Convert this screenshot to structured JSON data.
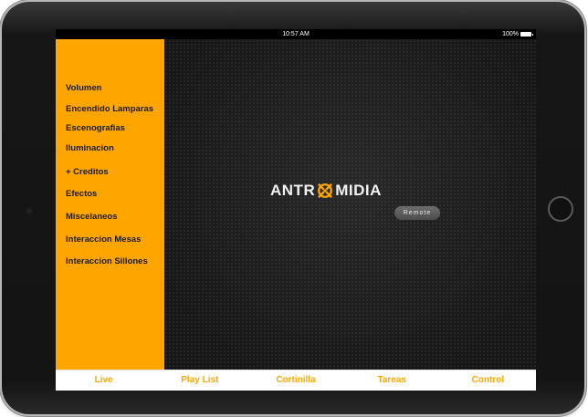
{
  "status_bar": {
    "time": "10:57 AM",
    "battery": "100%"
  },
  "sidebar": {
    "items": [
      {
        "label": "Volumen"
      },
      {
        "label": "Encendido Lamparas"
      },
      {
        "label": "Escenografias"
      },
      {
        "label": "Iluminacion"
      },
      {
        "label": "+ Creditos"
      },
      {
        "label": "Efectos"
      },
      {
        "label": "Miscelaneos"
      },
      {
        "label": "Interaccion Mesas"
      },
      {
        "label": "Interaccion Sillones"
      }
    ]
  },
  "logo": {
    "left_text": "ANTR",
    "right_text": "MIDIA",
    "mark_icon": "antromidia-logo-icon"
  },
  "remote_button": {
    "label": "Remote"
  },
  "tabs": [
    {
      "label": "Live"
    },
    {
      "label": "Play List"
    },
    {
      "label": "Cortinilla"
    },
    {
      "label": "Tareas"
    },
    {
      "label": "Control"
    }
  ],
  "colors": {
    "accent": "#ffa500",
    "sidebar_text": "#1a1a1a",
    "tabbar_bg": "#ffffff"
  }
}
